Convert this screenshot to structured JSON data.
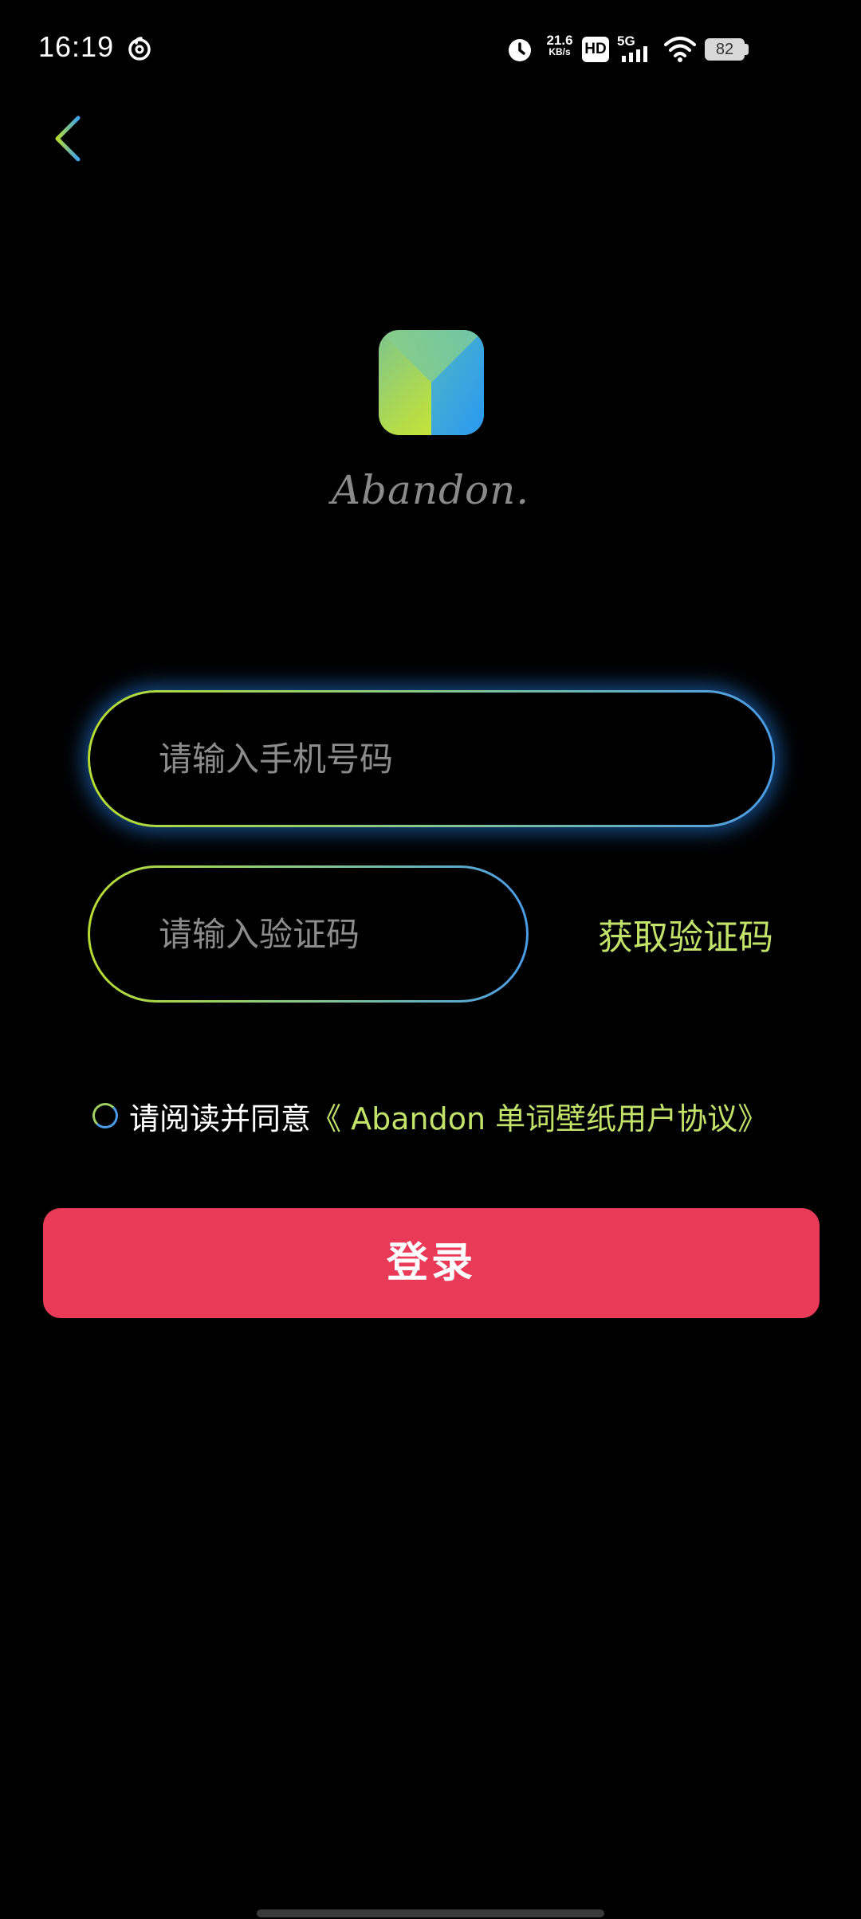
{
  "status_bar": {
    "time": "16:19",
    "net_speed_value": "21.6",
    "net_speed_unit": "KB/s",
    "hd_label": "HD",
    "network_label": "5G",
    "battery_level": "82"
  },
  "brand": {
    "wordmark": "Abandon."
  },
  "form": {
    "phone_placeholder": "请输入手机号码",
    "code_placeholder": "请输入验证码",
    "get_code_label": "获取验证码",
    "agreement_prefix": "请阅读并同意",
    "agreement_link": "《 Abandon 单词壁纸用户协议》",
    "login_label": "登录"
  },
  "colors": {
    "background": "#000000",
    "accent_green": "#c2e36a",
    "accent_blue": "#4a9be8",
    "login_button": "#e93a57"
  }
}
